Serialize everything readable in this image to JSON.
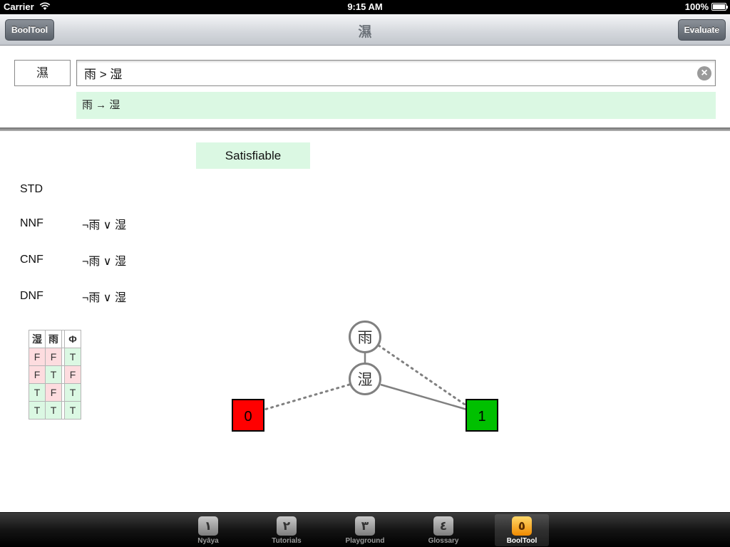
{
  "status": {
    "carrier": "Carrier",
    "time": "9:15 AM",
    "battery": "100%"
  },
  "nav": {
    "left_button": "BoolTool",
    "title": "濕",
    "right_button": "Evaluate"
  },
  "input": {
    "symbol": "濕",
    "formula": "雨 > 湿",
    "parsed": "雨 → 湿"
  },
  "result": {
    "status": "Satisfiable"
  },
  "forms": [
    {
      "label": "STD",
      "value": ""
    },
    {
      "label": "NNF",
      "value": "¬雨 ∨ 湿"
    },
    {
      "label": "CNF",
      "value": "¬雨 ∨ 湿"
    },
    {
      "label": "DNF",
      "value": "¬雨 ∨ 湿"
    }
  ],
  "truth_table": {
    "headers": [
      "湿",
      "雨",
      "Φ"
    ],
    "rows": [
      [
        "F",
        "F",
        "T"
      ],
      [
        "F",
        "T",
        "F"
      ],
      [
        "T",
        "F",
        "T"
      ],
      [
        "T",
        "T",
        "T"
      ]
    ]
  },
  "bdd": {
    "nodes": [
      "雨",
      "湿"
    ],
    "terminals": [
      "0",
      "1"
    ],
    "colors": {
      "false_terminal": "#ff0000",
      "true_terminal": "#00c000",
      "node_stroke": "#808080"
    }
  },
  "tabs": [
    {
      "icon": "١",
      "label": "Nyāya"
    },
    {
      "icon": "٢",
      "label": "Tutorials"
    },
    {
      "icon": "٣",
      "label": "Playground"
    },
    {
      "icon": "٤",
      "label": "Glossary"
    },
    {
      "icon": "٥",
      "label": "BoolTool"
    }
  ]
}
